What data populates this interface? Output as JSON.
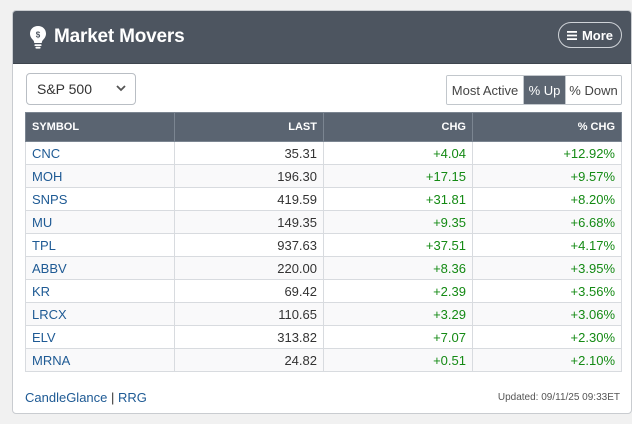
{
  "header": {
    "title": "Market Movers",
    "more_label": "More"
  },
  "index_select": {
    "value": "S&P 500"
  },
  "tabs": [
    {
      "label": "Most Active",
      "active": false
    },
    {
      "label": "% Up",
      "active": true
    },
    {
      "label": "% Down",
      "active": false
    }
  ],
  "table": {
    "columns": [
      "SYMBOL",
      "LAST",
      "CHG",
      "% CHG"
    ],
    "rows": [
      {
        "symbol": "CNC",
        "last": "35.31",
        "chg": "+4.04",
        "pct": "+12.92%"
      },
      {
        "symbol": "MOH",
        "last": "196.30",
        "chg": "+17.15",
        "pct": "+9.57%"
      },
      {
        "symbol": "SNPS",
        "last": "419.59",
        "chg": "+31.81",
        "pct": "+8.20%"
      },
      {
        "symbol": "MU",
        "last": "149.35",
        "chg": "+9.35",
        "pct": "+6.68%"
      },
      {
        "symbol": "TPL",
        "last": "937.63",
        "chg": "+37.51",
        "pct": "+4.17%"
      },
      {
        "symbol": "ABBV",
        "last": "220.00",
        "chg": "+8.36",
        "pct": "+3.95%"
      },
      {
        "symbol": "KR",
        "last": "69.42",
        "chg": "+2.39",
        "pct": "+3.56%"
      },
      {
        "symbol": "LRCX",
        "last": "110.65",
        "chg": "+3.29",
        "pct": "+3.06%"
      },
      {
        "symbol": "ELV",
        "last": "313.82",
        "chg": "+7.07",
        "pct": "+2.30%"
      },
      {
        "symbol": "MRNA",
        "last": "24.82",
        "chg": "+0.51",
        "pct": "+2.10%"
      }
    ]
  },
  "footer": {
    "link1": "CandleGlance",
    "separator": "|",
    "link2": "RRG",
    "updated": "Updated: 09/11/25 09:33ET"
  },
  "colors": {
    "header_bg": "#4d5560",
    "positive": "#148a14",
    "link": "#1e5a94",
    "active_tab": "#5d6672"
  },
  "icons": [
    "lightbulb-icon",
    "menu-icon",
    "chevron-down-icon"
  ]
}
